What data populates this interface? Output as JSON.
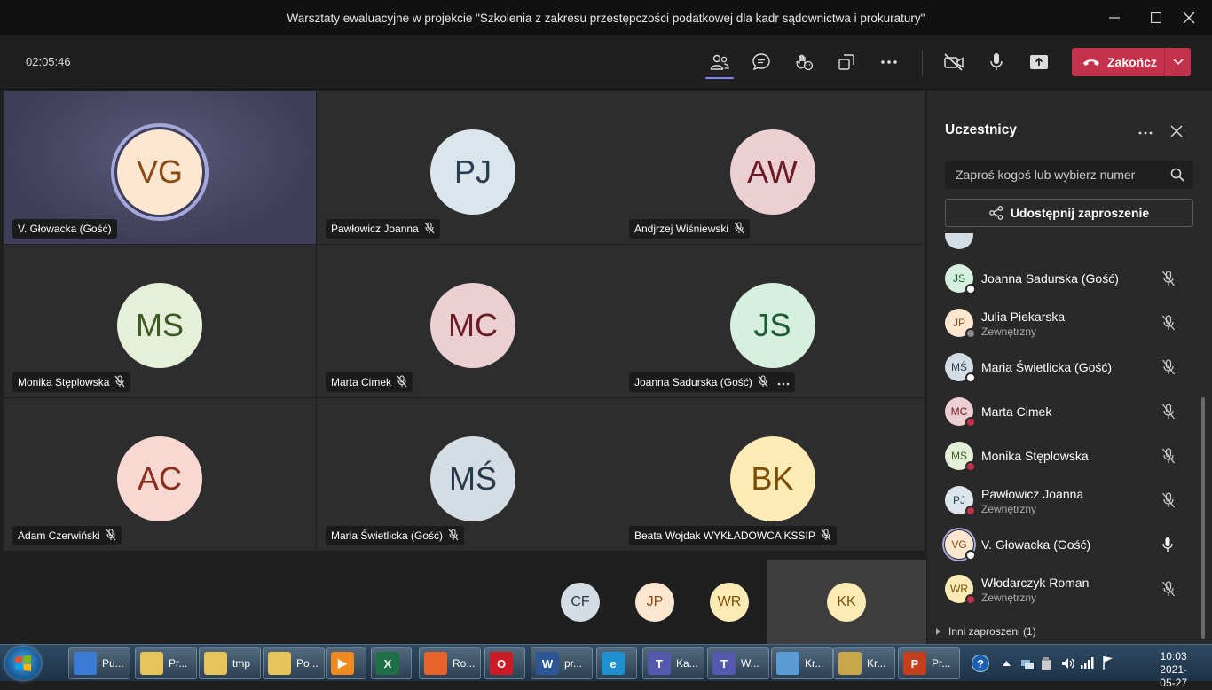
{
  "window": {
    "title": "Warsztaty ewaluacyjne w projekcie \"Szkolenia z zakresu przestępczości podatkowej dla kadr sądownictwa i prokuratury\""
  },
  "toolbar": {
    "timer": "02:05:46",
    "end_label": "Zakończ"
  },
  "tiles": [
    {
      "initials": "VG",
      "name": "V. Głowacka (Gość)",
      "bg": "#fde7d0",
      "fg": "#8a4b14",
      "muted": false
    },
    {
      "initials": "PJ",
      "name": "Pawłowicz Joanna",
      "bg": "#dae5ec",
      "fg": "#2a3f52",
      "muted": true
    },
    {
      "initials": "AW",
      "name": "Andjrzej Wiśniewski",
      "bg": "#eccfd2",
      "fg": "#6b1c24",
      "muted": true
    },
    {
      "initials": "MS",
      "name": "Monika Stęplowska",
      "bg": "#e6efd8",
      "fg": "#3d5a26",
      "muted": true
    },
    {
      "initials": "MC",
      "name": "Marta Cimek",
      "bg": "#eccfd2",
      "fg": "#6b1c24",
      "muted": true
    },
    {
      "initials": "JS",
      "name": "Joanna Sadurska (Gość)",
      "bg": "#d6f0e0",
      "fg": "#1c5a36",
      "muted": true
    },
    {
      "initials": "AC",
      "name": "Adam Czerwiński",
      "bg": "#f8d9d2",
      "fg": "#8a2d1c",
      "muted": true
    },
    {
      "initials": "MŚ",
      "name": "Maria Świetlicka (Gość)",
      "bg": "#d3dde3",
      "fg": "#263b4a",
      "muted": true
    },
    {
      "initials": "BK",
      "name": "Beata Wojdak WYKŁADOWCA KSSIP",
      "bg": "#fcebb5",
      "fg": "#7a4e08",
      "muted": true
    }
  ],
  "strip": [
    {
      "initials": "CF",
      "bg": "#d3dde3",
      "fg": "#263b4a"
    },
    {
      "initials": "JP",
      "bg": "#fde7d0",
      "fg": "#8a4b14"
    },
    {
      "initials": "WR",
      "bg": "#fcebb5",
      "fg": "#7a4e08"
    },
    {
      "initials": "KK",
      "bg": "#fcebb5",
      "fg": "#7a4e08"
    }
  ],
  "panel": {
    "title": "Uczestnicy",
    "search_placeholder": "Zaproś kogoś lub wybierz numer",
    "share_label": "Udostępnij zaproszenie",
    "others_label": "Inni zaproszeni (1)",
    "participants": [
      {
        "initials": "JS",
        "name": "Joanna Sadurska (Gość)",
        "sub": "",
        "bg": "#d6f0e0",
        "fg": "#1c5a36",
        "status": "#ffffff",
        "mic": "muted"
      },
      {
        "initials": "JP",
        "name": "Julia Piekarska",
        "sub": "Zewnętrzny",
        "bg": "#fde7d0",
        "fg": "#8a4b14",
        "status": "#8a8a8a",
        "mic": "muted"
      },
      {
        "initials": "MŚ",
        "name": "Maria Świetlicka (Gość)",
        "sub": "",
        "bg": "#d3dde3",
        "fg": "#263b4a",
        "status": "#ffffff",
        "mic": "muted"
      },
      {
        "initials": "MC",
        "name": "Marta Cimek",
        "sub": "",
        "bg": "#eccfd2",
        "fg": "#6b1c24",
        "status": "#c4314b",
        "mic": "muted"
      },
      {
        "initials": "MS",
        "name": "Monika Stęplowska",
        "sub": "",
        "bg": "#e6efd8",
        "fg": "#3d5a26",
        "status": "#c4314b",
        "mic": "muted"
      },
      {
        "initials": "PJ",
        "name": "Pawłowicz Joanna",
        "sub": "Zewnętrzny",
        "bg": "#dae5ec",
        "fg": "#2a3f52",
        "status": "#c4314b",
        "mic": "muted"
      },
      {
        "initials": "VG",
        "name": "V. Głowacka (Gość)",
        "sub": "",
        "bg": "#fde7d0",
        "fg": "#8a4b14",
        "status": "#ffffff",
        "mic": "on"
      },
      {
        "initials": "WR",
        "name": "Włodarczyk Roman",
        "sub": "Zewnętrzny",
        "bg": "#fcebb5",
        "fg": "#7a4e08",
        "status": "#c4314b",
        "mic": "muted"
      }
    ]
  },
  "taskbar": {
    "buttons": [
      {
        "label": "Pu...",
        "icon": "monitor-icon",
        "color": "#3a7bd5",
        "glyph": ""
      },
      {
        "label": "Pr...",
        "icon": "folder-icon",
        "color": "#e8c35a",
        "glyph": ""
      },
      {
        "label": "tmp",
        "icon": "folder-icon",
        "color": "#e8c35a",
        "glyph": ""
      },
      {
        "label": "Po...",
        "icon": "folder-icon",
        "color": "#e8c35a",
        "glyph": ""
      },
      {
        "label": "",
        "icon": "media-player-icon",
        "color": "#f08a1c",
        "glyph": "▶"
      },
      {
        "label": "",
        "icon": "excel-icon",
        "color": "#1d7044",
        "glyph": "X"
      },
      {
        "label": "Ro...",
        "icon": "firefox-icon",
        "color": "#e7622b",
        "glyph": ""
      },
      {
        "label": "",
        "icon": "opera-icon",
        "color": "#cc1b24",
        "glyph": "O"
      },
      {
        "label": "pr...",
        "icon": "word-icon",
        "color": "#2b5797",
        "glyph": "W"
      },
      {
        "label": "",
        "icon": "edge-icon",
        "color": "#1e8fcf",
        "glyph": "e"
      },
      {
        "label": "Ka...",
        "icon": "teams-icon",
        "color": "#5558af",
        "glyph": "T"
      },
      {
        "label": "W...",
        "icon": "teams-icon",
        "color": "#5558af",
        "glyph": "T"
      },
      {
        "label": "Kr...",
        "icon": "photo-viewer-icon",
        "color": "#5b9bd5",
        "glyph": ""
      },
      {
        "label": "Kr...",
        "icon": "paint-icon",
        "color": "#c9a64a",
        "glyph": ""
      },
      {
        "label": "Pr...",
        "icon": "powerpoint-icon",
        "color": "#c43e1c",
        "glyph": "P"
      }
    ],
    "time": "10:03",
    "date": "2021-05-27"
  }
}
